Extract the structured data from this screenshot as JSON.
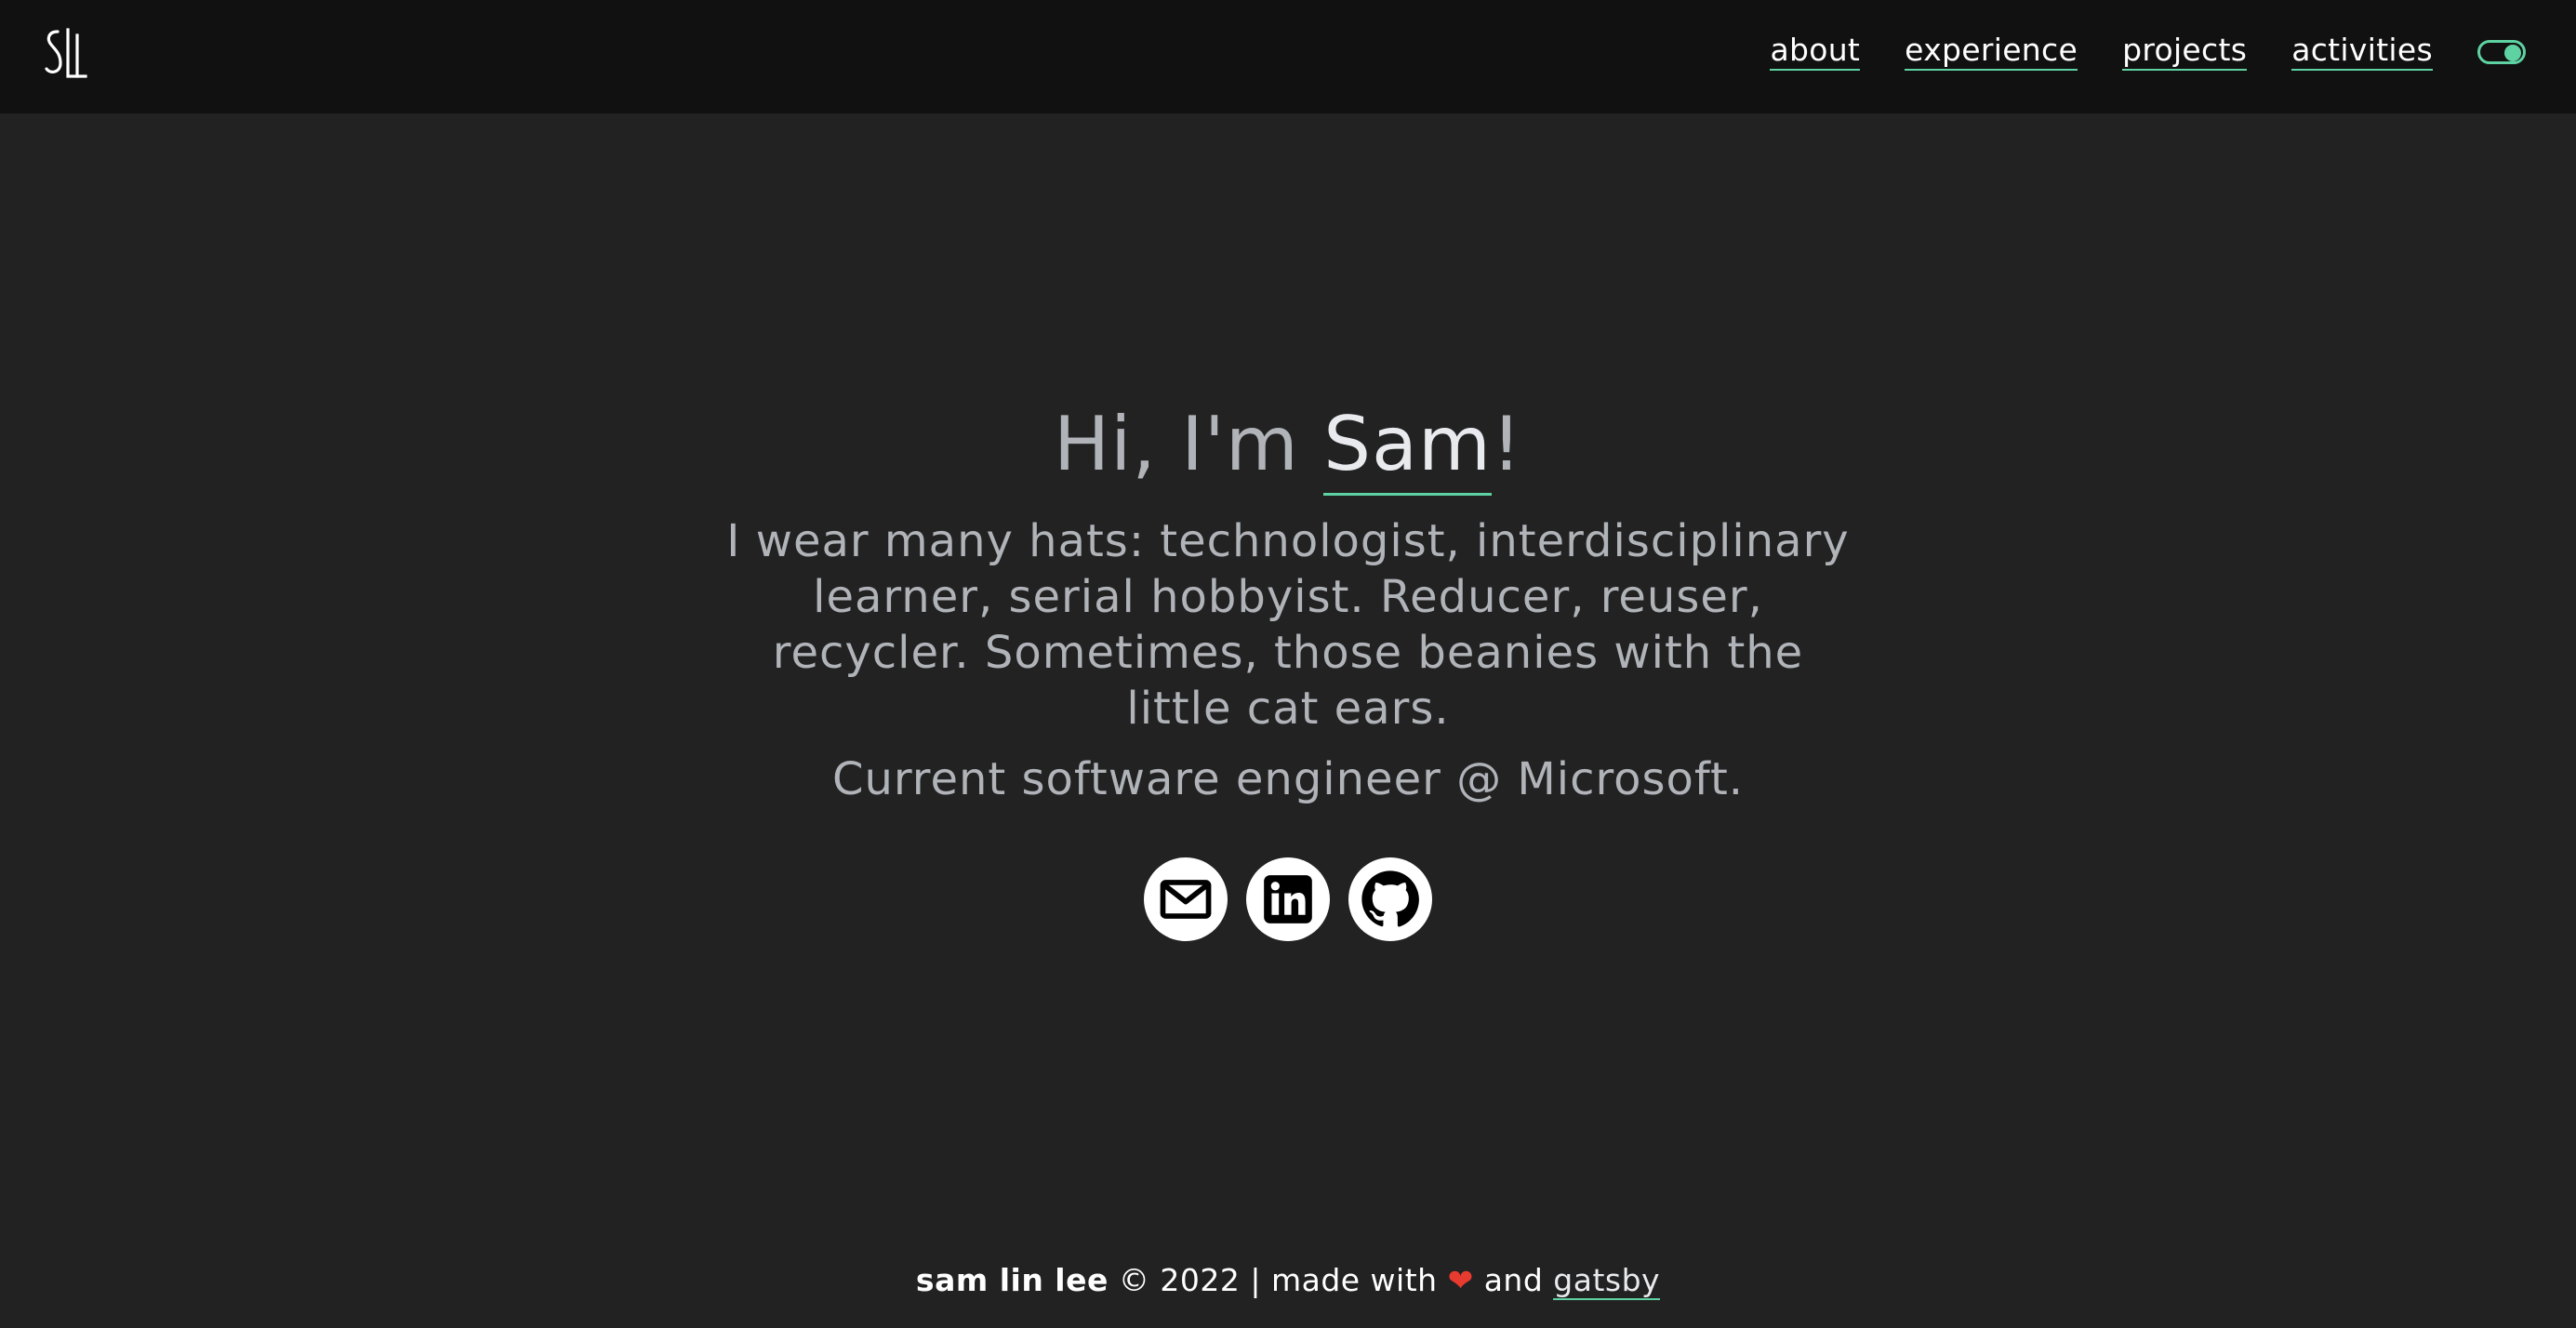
{
  "header": {
    "logo_text": "SLL",
    "nav": [
      {
        "label": "about"
      },
      {
        "label": "experience"
      },
      {
        "label": "projects"
      },
      {
        "label": "activities"
      }
    ],
    "theme_toggle": {
      "state": "on"
    }
  },
  "hero": {
    "greeting_prefix": "Hi, I'm ",
    "name": "Sam",
    "greeting_suffix": "!",
    "bio": "I wear many hats: technologist, interdisciplinary learner, serial hobbyist. Reducer, reuser, recycler. Sometimes, those beanies with the little cat ears.",
    "role": "Current software engineer @ Microsoft.",
    "socials": [
      {
        "icon": "mail-icon"
      },
      {
        "icon": "linkedin-icon"
      },
      {
        "icon": "github-icon"
      }
    ]
  },
  "footer": {
    "name": "sam lin lee",
    "copyright": " © 2022 | made with ",
    "heart": "❤",
    "and": " and ",
    "link": "gatsby"
  },
  "colors": {
    "background": "#222222",
    "header_background": "#111111",
    "accent": "#5ed2a2",
    "heart": "#e63b2e"
  }
}
